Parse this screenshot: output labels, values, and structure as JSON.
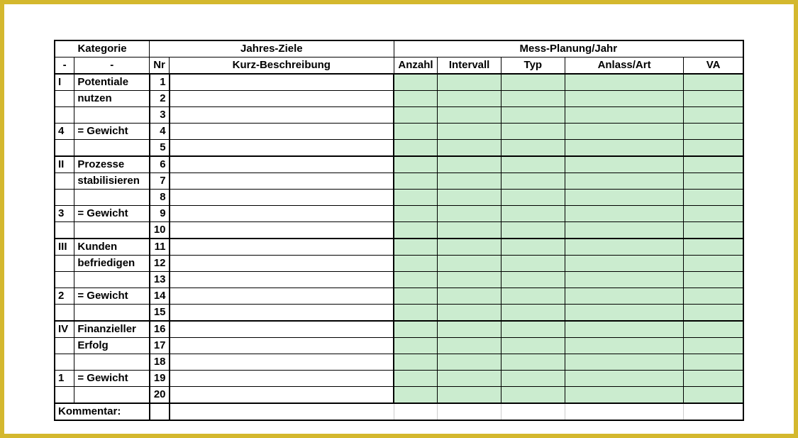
{
  "headers": {
    "kategorie": "Kategorie",
    "jahresziele": "Jahres-Ziele",
    "messplanung": "Mess-Planung/Jahr",
    "dash": "-",
    "nr": "Nr",
    "kurz": "Kurz-Beschreibung",
    "anzahl": "Anzahl",
    "intervall": "Intervall",
    "typ": "Typ",
    "anlass": "Anlass/Art",
    "va": "VA"
  },
  "blocks": [
    {
      "roman": "I",
      "title_lines": [
        "Potentiale",
        "nutzen"
      ],
      "weight_num": "4",
      "weight_label": "= Gewicht",
      "rows": [
        1,
        2,
        3,
        4,
        5
      ]
    },
    {
      "roman": "II",
      "title_lines": [
        "Prozesse",
        "stabilisieren"
      ],
      "weight_num": "3",
      "weight_label": "= Gewicht",
      "rows": [
        6,
        7,
        8,
        9,
        10
      ]
    },
    {
      "roman": "III",
      "title_lines": [
        "Kunden",
        "befriedigen"
      ],
      "weight_num": "2",
      "weight_label": "= Gewicht",
      "rows": [
        11,
        12,
        13,
        14,
        15
      ]
    },
    {
      "roman": "IV",
      "title_lines": [
        "Finanzieller",
        "Erfolg"
      ],
      "weight_num": "1",
      "weight_label": "= Gewicht",
      "rows": [
        16,
        17,
        18,
        19,
        20
      ]
    }
  ],
  "kommentar_label": "Kommentar:"
}
